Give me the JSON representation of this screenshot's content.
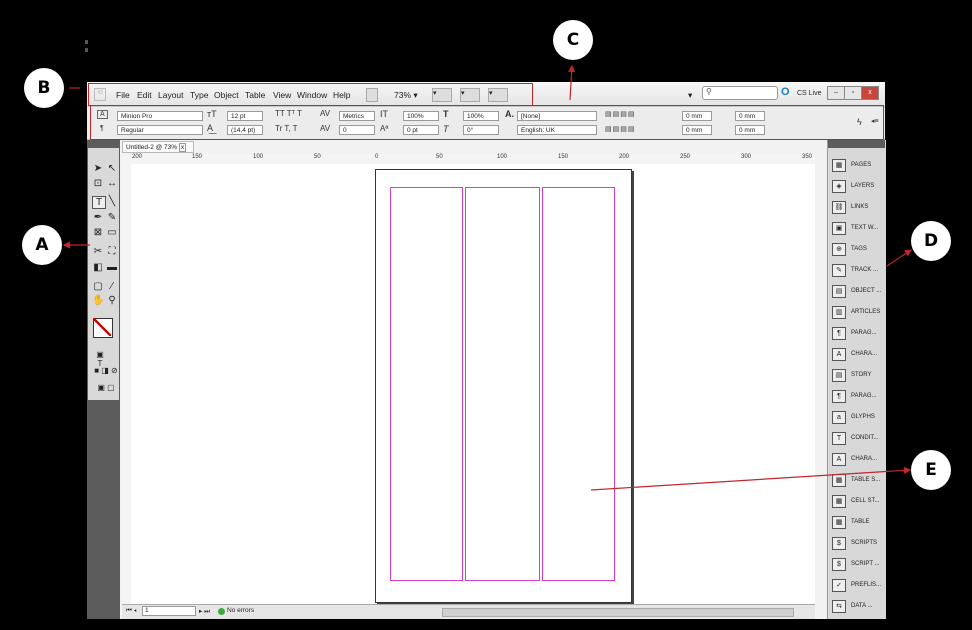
{
  "callouts": {
    "a": "A",
    "b": "B",
    "c": "C",
    "d": "D",
    "e": "E"
  },
  "menu": [
    "File",
    "Edit",
    "Layout",
    "Type",
    "Object",
    "Table",
    "View",
    "Window",
    "Help"
  ],
  "zoom": "73%",
  "cs_live": "CS Live",
  "control": {
    "font_family": "Minion Pro",
    "font_style": "Regular",
    "font_size": "12 pt",
    "leading": "(14,4 pt)",
    "kerning": "Metrics",
    "tracking": "0",
    "vscale": "100%",
    "hscale": "100%",
    "baseline": "0 pt",
    "skew": "0°",
    "char_style": "[None]",
    "language": "English: UK",
    "indent_left": "0 mm",
    "indent_right": "0 mm",
    "space_before": "0 mm",
    "space_after": "0 mm"
  },
  "document_tab": "Untitled-2 @ 73%",
  "ruler_ticks": [
    "200",
    "150",
    "100",
    "50",
    "0",
    "50",
    "100",
    "150",
    "200",
    "250",
    "300",
    "350"
  ],
  "status": {
    "page": "1",
    "errors": "No errors"
  },
  "panels": [
    "PAGES",
    "LAYERS",
    "LINKS",
    "TEXT W...",
    "TAGS",
    "TRACK ...",
    "OBJECT ...",
    "ARTICLES",
    "PARAG...",
    "CHARA...",
    "STORY",
    "PARAG...",
    "GLYPHS",
    "CONDIT...",
    "CHARA...",
    "TABLE S...",
    "CELL ST...",
    "TABLE",
    "SCRIPTS",
    "SCRIPT ...",
    "PREFLIS...",
    "DATA ..."
  ],
  "colors": {
    "annotation": "#c0262c",
    "margin_guides": "#d23fd2"
  }
}
